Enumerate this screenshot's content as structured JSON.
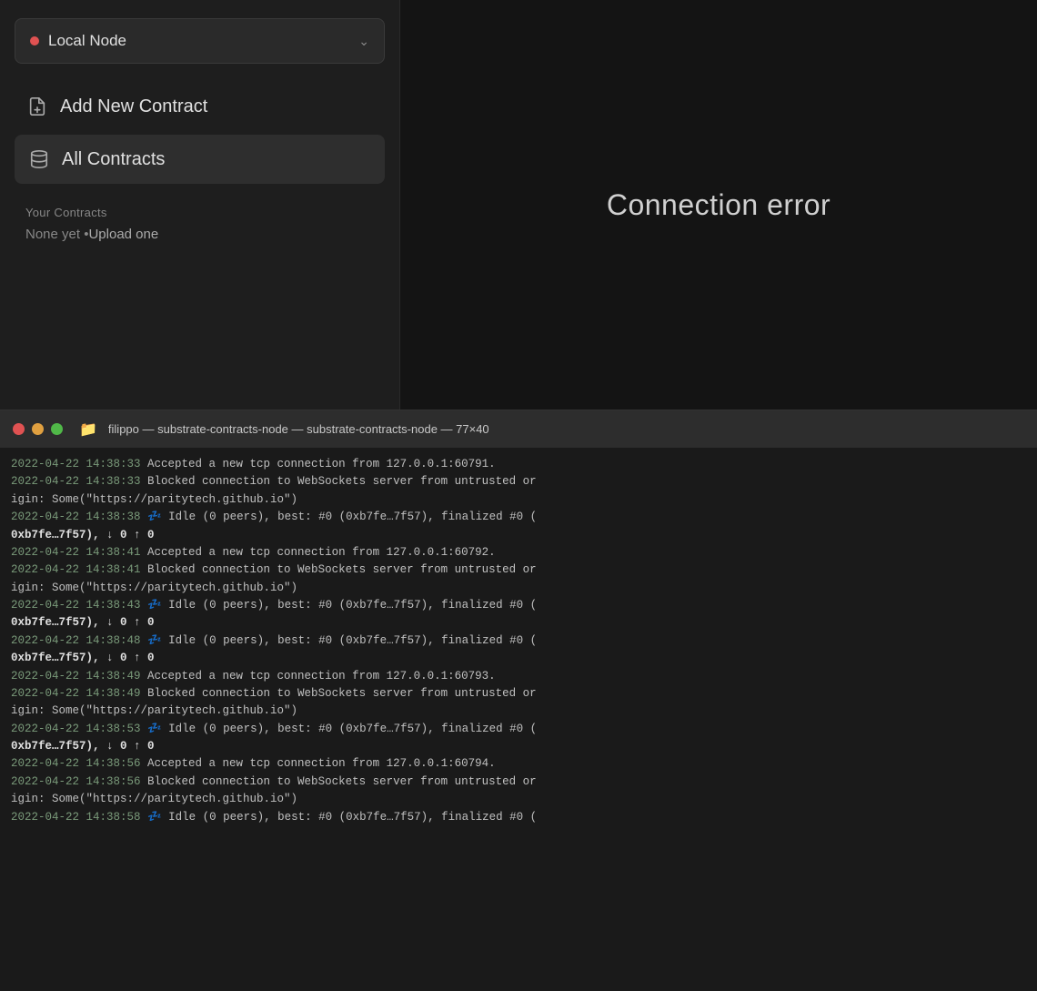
{
  "sidebar": {
    "nodeSelector": {
      "label": "Local Node",
      "dotColor": "#e05252",
      "chevron": "∨"
    },
    "addNewContract": {
      "label": "Add New Contract",
      "icon": "file-plus"
    },
    "allContracts": {
      "label": "All Contracts",
      "icon": "contracts"
    },
    "yourContracts": {
      "title": "Your Contracts",
      "emptyText": "None yet • ",
      "uploadLink": "Upload one"
    }
  },
  "main": {
    "connectionError": "Connection error"
  },
  "terminal": {
    "titlebar": {
      "icon": "📁",
      "title": "filippo — substrate-contracts-node — substrate-contracts-node — 77×40"
    },
    "logs": [
      {
        "id": 1,
        "timestamp": "2022-04-22 14:38:33",
        "message": " Accepted a new tcp connection from 127.0.0.1:60791."
      },
      {
        "id": 2,
        "timestamp": "2022-04-22 14:38:33",
        "message": " Blocked connection to WebSockets server from untrusted or"
      },
      {
        "id": 3,
        "timestamp": "",
        "message": "igin: Some(\"https://paritytech.github.io\")"
      },
      {
        "id": 4,
        "timestamp": "2022-04-22 14:38:38",
        "message": " 💤 Idle (0 peers), best: #0 (0xb7fe…7f57), finalized #0 (",
        "bold": "0xb7fe…7f57), ↓ 0 ↑ 0"
      },
      {
        "id": 5,
        "timestamp": "2022-04-22 14:38:41",
        "message": " Accepted a new tcp connection from 127.0.0.1:60792."
      },
      {
        "id": 6,
        "timestamp": "2022-04-22 14:38:41",
        "message": " Blocked connection to WebSockets server from untrusted or"
      },
      {
        "id": 7,
        "timestamp": "",
        "message": "igin: Some(\"https://paritytech.github.io\")"
      },
      {
        "id": 8,
        "timestamp": "2022-04-22 14:38:43",
        "message": " 💤 Idle (0 peers), best: #0 (0xb7fe…7f57), finalized #0 (",
        "bold": "0xb7fe…7f57), ↓ 0 ↑ 0"
      },
      {
        "id": 9,
        "timestamp": "2022-04-22 14:38:48",
        "message": " 💤 Idle (0 peers), best: #0 (0xb7fe…7f57), finalized #0 (",
        "bold": "0xb7fe…7f57), ↓ 0 ↑ 0"
      },
      {
        "id": 10,
        "timestamp": "2022-04-22 14:38:49",
        "message": " Accepted a new tcp connection from 127.0.0.1:60793."
      },
      {
        "id": 11,
        "timestamp": "2022-04-22 14:38:49",
        "message": " Blocked connection to WebSockets server from untrusted or"
      },
      {
        "id": 12,
        "timestamp": "",
        "message": "igin: Some(\"https://paritytech.github.io\")"
      },
      {
        "id": 13,
        "timestamp": "2022-04-22 14:38:53",
        "message": " 💤 Idle (0 peers), best: #0 (0xb7fe…7f57), finalized #0 (",
        "bold": "0xb7fe…7f57), ↓ 0 ↑ 0"
      },
      {
        "id": 14,
        "timestamp": "2022-04-22 14:38:56",
        "message": " Accepted a new tcp connection from 127.0.0.1:60794."
      },
      {
        "id": 15,
        "timestamp": "2022-04-22 14:38:56",
        "message": " Blocked connection to WebSockets server from untrusted or"
      },
      {
        "id": 16,
        "timestamp": "",
        "message": "igin: Some(\"https://paritytech.github.io\")"
      }
    ]
  }
}
